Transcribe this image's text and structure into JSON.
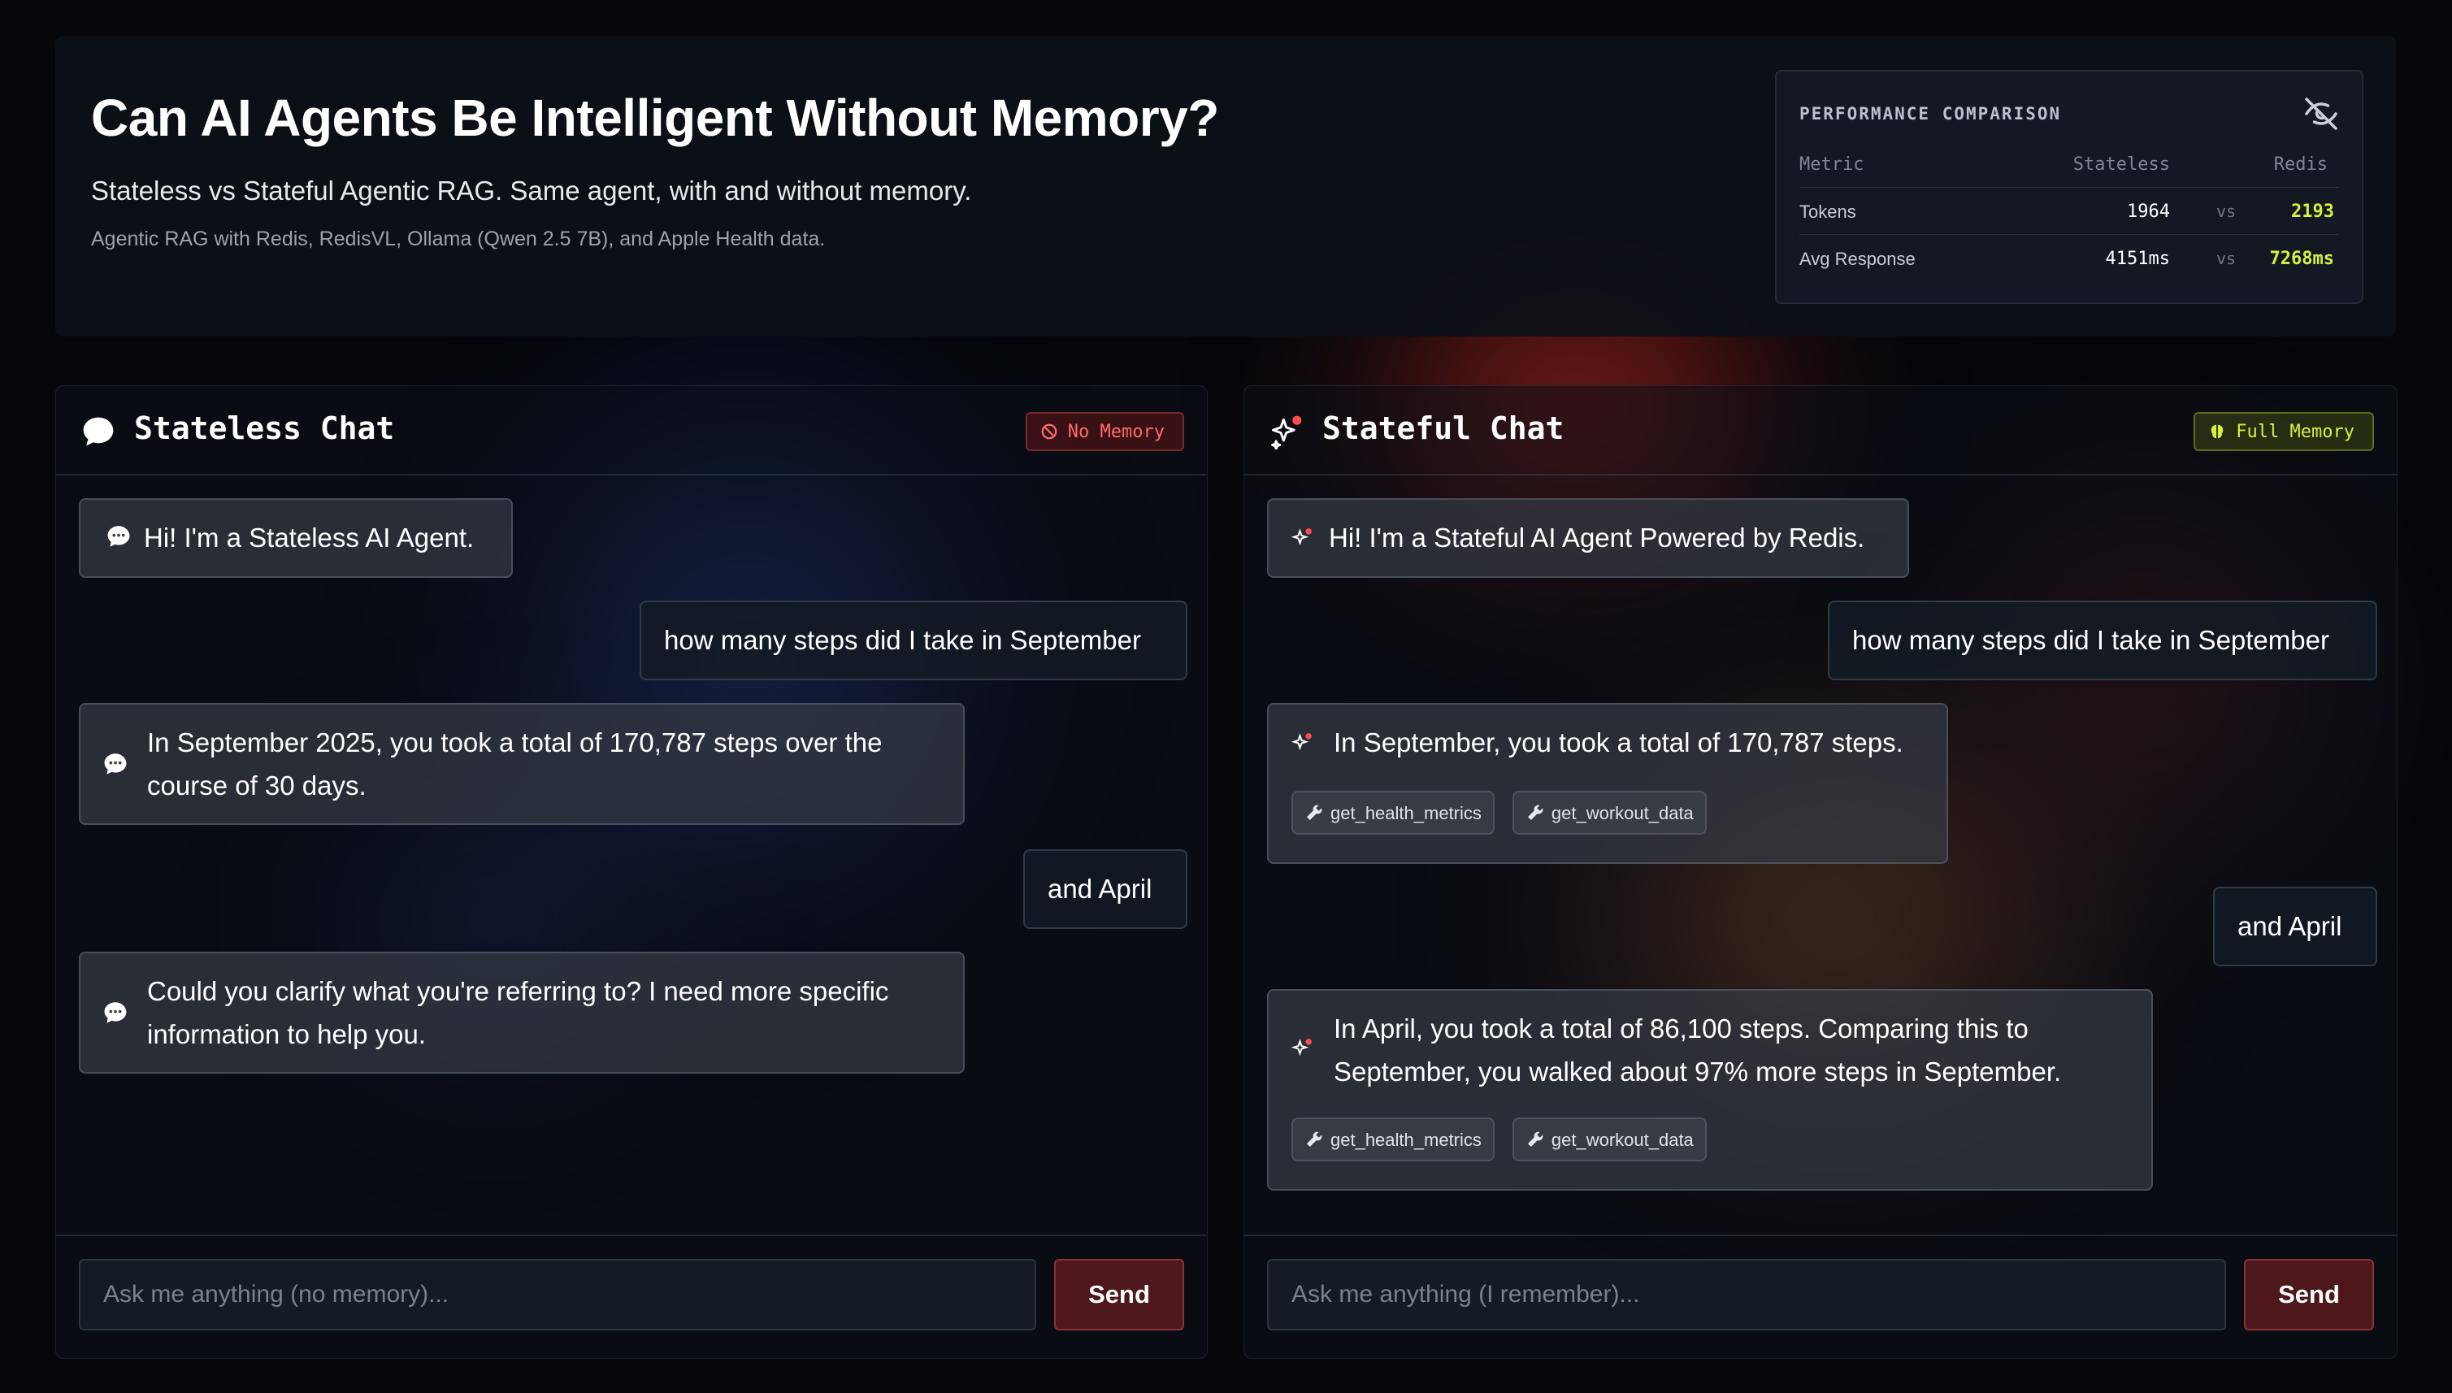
{
  "header": {
    "title": "Can AI Agents Be Intelligent Without Memory?",
    "subtitle": "Stateless vs Stateful Agentic RAG. Same agent, with and without memory.",
    "tagline": "Agentic RAG with Redis, RedisVL, Ollama (Qwen 2.5 7B), and Apple Health data."
  },
  "performance": {
    "title": "PERFORMANCE COMPARISON",
    "toggle_icon": "eye-off-icon",
    "columns": {
      "metric": "Metric",
      "stateless": "Stateless",
      "redis": "Redis"
    },
    "rows": [
      {
        "metric": "Tokens",
        "stateless": "1964",
        "vs": "vs",
        "redis": "2193"
      },
      {
        "metric": "Avg Response",
        "stateless": "4151ms",
        "vs": "vs",
        "redis": "7268ms"
      }
    ]
  },
  "colors": {
    "accent_lime": "#d8f03c",
    "badge_red": "#ff6b6b",
    "send_red": "#5a1a1e"
  },
  "stateless": {
    "title": "Stateless Chat",
    "icon": "chat-bubble-icon",
    "badge": "No Memory",
    "badge_icon": "no-entry-icon",
    "messages": [
      {
        "role": "bot",
        "text": "Hi! I'm a Stateless AI Agent."
      },
      {
        "role": "user",
        "text": "how many steps did I take in September"
      },
      {
        "role": "bot",
        "text": "In September 2025, you took a total of 170,787 steps over the course of 30 days."
      },
      {
        "role": "user",
        "text": "and April"
      },
      {
        "role": "bot",
        "text": "Could you clarify what you're referring to? I need more specific information to help you."
      }
    ],
    "input_placeholder": "Ask me anything (no memory)...",
    "send_label": "Send"
  },
  "stateful": {
    "title": "Stateful Chat",
    "icon": "sparkle-icon",
    "badge": "Full Memory",
    "badge_icon": "brain-icon",
    "messages": [
      {
        "role": "bot",
        "text": "Hi! I'm a Stateful AI Agent Powered by Redis."
      },
      {
        "role": "user",
        "text": "how many steps did I take in September"
      },
      {
        "role": "bot",
        "text": "In September, you took a total of 170,787 steps.",
        "tools": [
          "get_health_metrics",
          "get_workout_data"
        ]
      },
      {
        "role": "user",
        "text": "and April"
      },
      {
        "role": "bot",
        "text": "In April, you took a total of 86,100 steps. Comparing this to September, you walked about 97% more steps in September.",
        "tools": [
          "get_health_metrics",
          "get_workout_data"
        ]
      }
    ],
    "input_placeholder": "Ask me anything (I remember)...",
    "send_label": "Send"
  }
}
